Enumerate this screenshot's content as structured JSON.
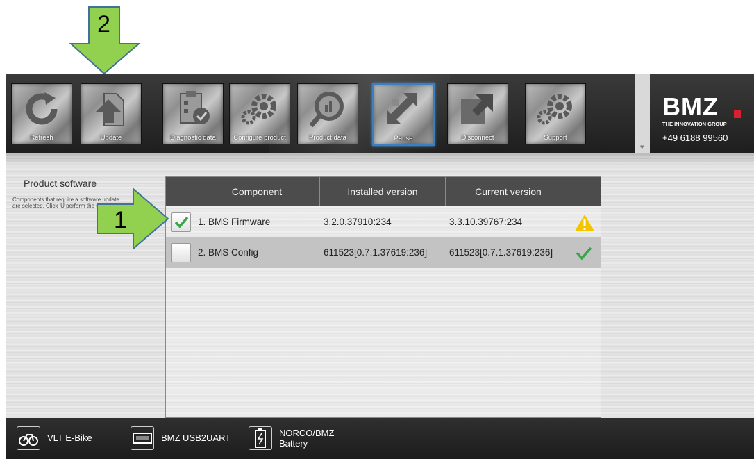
{
  "toolbar": {
    "buttons": [
      {
        "label": "Refresh",
        "icon": "refresh-icon"
      },
      {
        "label": "Update",
        "icon": "update-icon"
      },
      {
        "label": "Diagnostic data",
        "icon": "clipboard-check-icon"
      },
      {
        "label": "Configure product",
        "icon": "gears-icon"
      },
      {
        "label": "Product data",
        "icon": "magnifier-chart-icon"
      },
      {
        "label": "Pause",
        "icon": "pause-arrows-icon",
        "active": true
      },
      {
        "label": "Disconnect",
        "icon": "disconnect-icon"
      },
      {
        "label": "Support",
        "icon": "gears-icon"
      }
    ]
  },
  "brand": {
    "logo_text": "BMZ",
    "tagline": "THE INNOVATION GROUP",
    "phone": "+49 6188 99560",
    "accent_color": "#d8202e"
  },
  "sidebar": {
    "title": "Product software",
    "description": "Components that require a software update are selected. Click 'U perform the update."
  },
  "table": {
    "headers": [
      "Component",
      "Installed version",
      "Current version"
    ],
    "rows": [
      {
        "checked": true,
        "component": "1. BMS Firmware",
        "installed": "3.2.0.37910:234",
        "current": "3.3.10.39767:234",
        "status": "warning-icon"
      },
      {
        "checked": false,
        "component": "2. BMS Config",
        "installed": "611523[0.7.1.37619:236]",
        "current": "611523[0.7.1.37619:236]",
        "status": "ok-check-icon"
      }
    ]
  },
  "footer": {
    "items": [
      {
        "label": "VLT E-Bike",
        "icon": "bike-icon"
      },
      {
        "label": "BMZ USB2UART",
        "icon": "usb-adapter-icon"
      },
      {
        "label_line1": "NORCO/BMZ",
        "label_line2": "Battery",
        "icon": "battery-icon"
      }
    ]
  },
  "annotations": {
    "arrow1_number": "1",
    "arrow2_number": "2",
    "arrow_color": "#92d050"
  }
}
